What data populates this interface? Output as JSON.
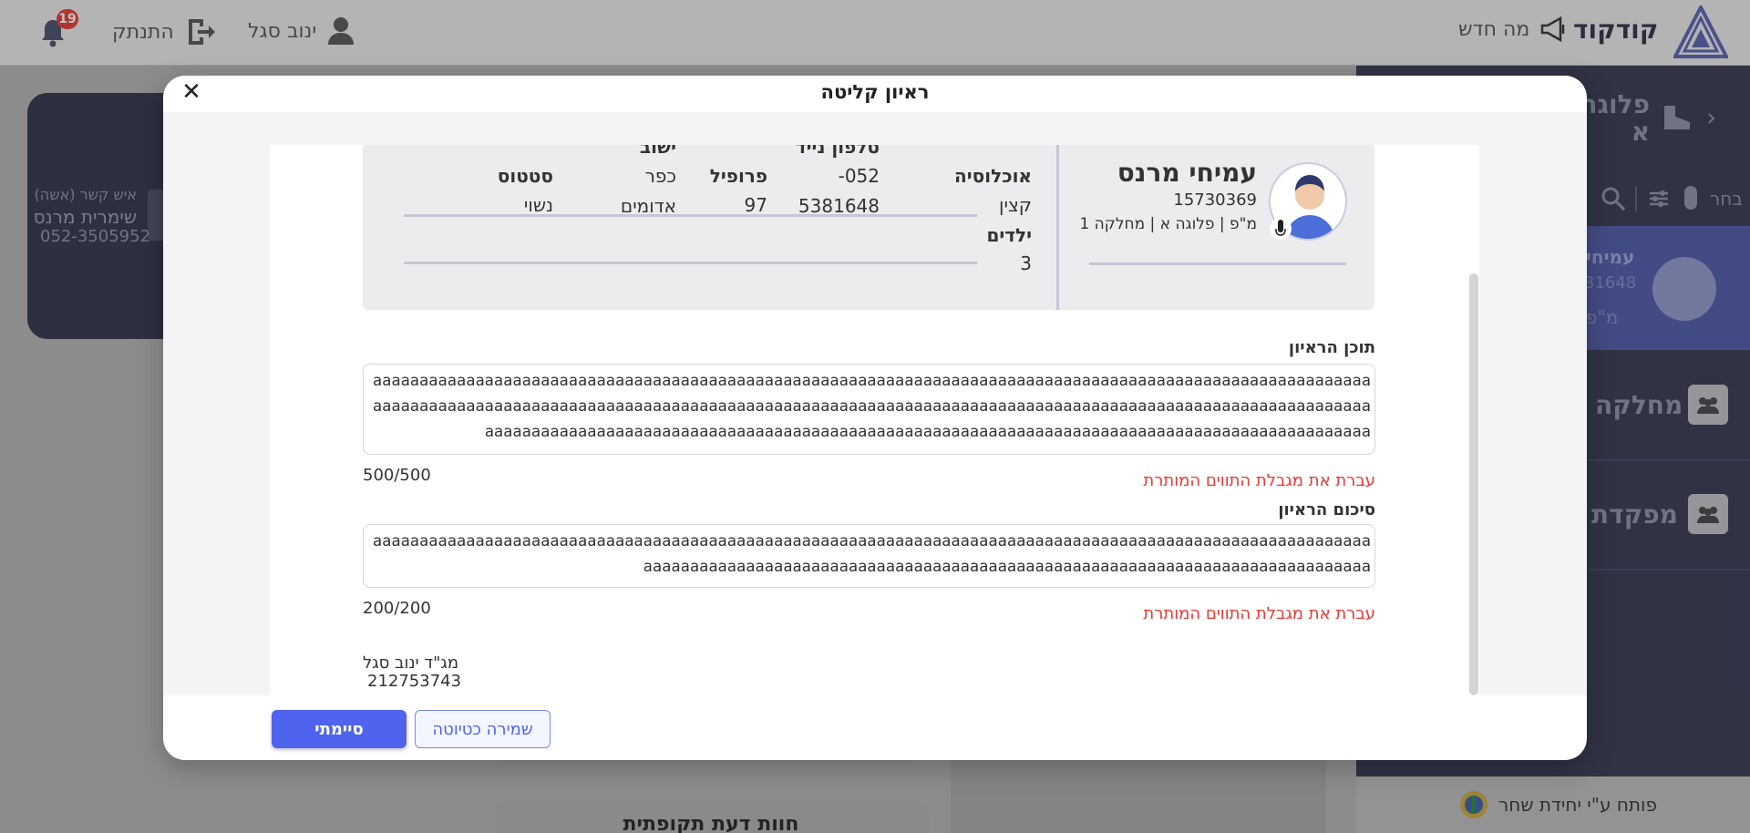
{
  "topbar": {
    "brand": "קודקוד",
    "whats_new": "מה חדש",
    "user_name": "ינוב סגל",
    "logout": "התנתק",
    "notif_count": "19"
  },
  "left_card": {
    "contact_label": "איש קשר (אשה)",
    "contact_name": "שימרית מרנס",
    "contact_phone": "052-3505952"
  },
  "sidebar": {
    "title": "פלוגה א",
    "select_label": "בחר",
    "selected_name": "עמיחי",
    "selected_id": "31648",
    "selected_sub": "מ\"פ",
    "item_mahlaka": "מחלקה",
    "item_mifkada": "מפקדת",
    "footer": "פותח ע\"י יחידת שחר"
  },
  "bottom_card_title": "חוות דעת תקופתית",
  "modal": {
    "title": "ראיון קליטה",
    "profile": {
      "name": "עמיחי מרנס",
      "id": "15730369",
      "role_line": "מ\"פ | פלוגה א | מחלקה 1"
    },
    "fields": {
      "population_label": "אוכלוסיה",
      "population_value": "קצין",
      "phone_label": "טלפון נייד",
      "phone_value_1": "-052",
      "phone_value_2": "5381648",
      "profile_label": "פרופיל",
      "profile_value": "97",
      "settlement_label": "ישוב",
      "settlement_value_1": "כפר",
      "settlement_value_2": "אדומים",
      "status_label": "סטטוס",
      "status_value": "נשוי",
      "children_label": "ילדים",
      "children_value": "3"
    },
    "interview_content_label": "תוכן הראיון",
    "interview_content_value": "aaaaaaaaaaaaaaaaaaaaaaaaaaaaaaaaaaaaaaaaaaaaaaaaaaaaaaaaaaaaaaaaaaaaaaaaaaaaaaaaaaaaaaaaaaaaaaaaaaaaaaaaaaaaaaaaaaaaaaaaaaaaaaaaaaaaaaaaaaaaaaaaaaaaaaaaaaaaaaaaaaaaaaaaaaaaaaaaaaaaaaaaaaaaaaaaaaaaaaaaaaaaaaaaaaaaaaaaaaaaaaaaaaaaaaaaaaaaaaaaaaaaaaaaaaaaaaaaaaaaaaaaaaaaaaaaaaaaaaaaaaaaaaaaaaaaaaaaaaaaaaaaaaaaa",
    "interview_content_count": "500/500",
    "interview_content_error": "עברת את מגבלת התווים המותרת",
    "summary_label": "סיכום הראיון",
    "summary_value": "aaaaaaaaaaaaaaaaaaaaaaaaaaaaaaaaaaaaaaaaaaaaaaaaaaaaaaaaaaaaaaaaaaaaaaaaaaaaaaaaaaaaaaaaaaaaaaaaaaaaaaaaaaaaaaaaaaaaaaaaaaaaaaaaaaaaaaaaaaaaaaaaaaaaaaaaaaaaaaaaaaaaaaaaaaaaaaaaaaaaaaaaa",
    "summary_count": "200/200",
    "summary_error": "עברת את מגבלת התווים המותרת",
    "interviewer_name": "מג\"ד ינוב סגל",
    "interviewer_id": "212753743",
    "save_draft": "שמירה כטיוטה",
    "done": "סיימתי"
  }
}
